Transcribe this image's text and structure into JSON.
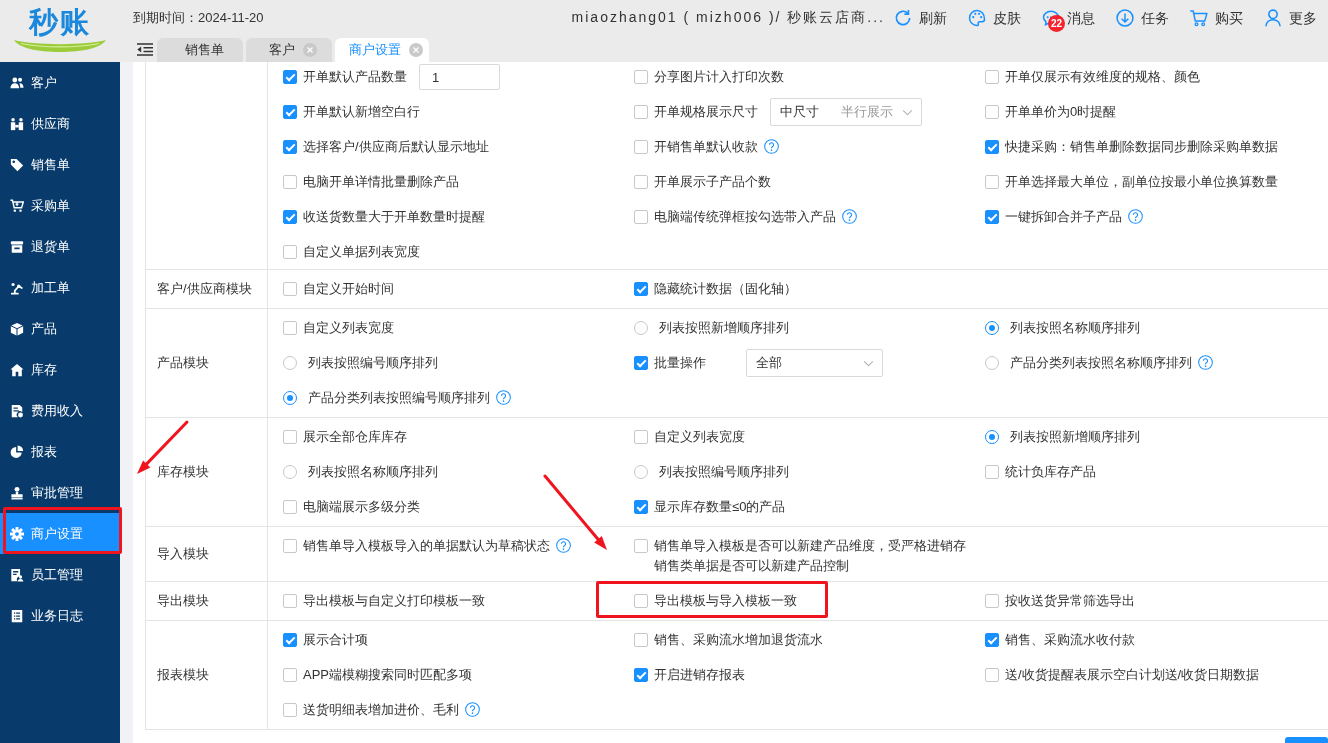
{
  "header": {
    "logo": "秒账",
    "expiry": "到期时间：2024-11-20",
    "account": "miaozhang01 ( mizh006 )/ 秒账云店商...",
    "toolbar": [
      {
        "kind": "refresh",
        "label": "刷新"
      },
      {
        "kind": "skin",
        "label": "皮肤"
      },
      {
        "kind": "messages",
        "label": "消息",
        "badge": "22"
      },
      {
        "kind": "tasks",
        "label": "任务"
      },
      {
        "kind": "buy",
        "label": "购买"
      },
      {
        "kind": "more",
        "label": "更多"
      }
    ]
  },
  "tabs": [
    {
      "label": "销售单",
      "selected": false,
      "closable": false
    },
    {
      "label": "客户",
      "selected": false,
      "closable": true
    },
    {
      "label": "商户设置",
      "selected": true,
      "closable": true
    }
  ],
  "sidebar": {
    "items": [
      {
        "kind": "customers",
        "label": "客户",
        "selected": false
      },
      {
        "kind": "suppliers",
        "label": "供应商",
        "selected": false
      },
      {
        "kind": "sales",
        "label": "销售单",
        "selected": false
      },
      {
        "kind": "purchases",
        "label": "采购单",
        "selected": false
      },
      {
        "kind": "returns",
        "label": "退货单",
        "selected": false
      },
      {
        "kind": "processing",
        "label": "加工单",
        "selected": false
      },
      {
        "kind": "products",
        "label": "产品",
        "selected": false
      },
      {
        "kind": "stock",
        "label": "库存",
        "selected": false
      },
      {
        "kind": "finance",
        "label": "费用收入",
        "selected": false
      },
      {
        "kind": "reports",
        "label": "报表",
        "selected": false
      },
      {
        "kind": "approvals",
        "label": "审批管理",
        "selected": false
      },
      {
        "kind": "settings",
        "label": "商户设置",
        "selected": true
      },
      {
        "kind": "staff",
        "label": "员工管理",
        "selected": false
      },
      {
        "kind": "logs",
        "label": "业务日志",
        "selected": false
      }
    ]
  },
  "settings": {
    "sections": [
      {
        "items": [
          {
            "kind": "checkbox",
            "label": "开单默认产品数量",
            "checked": true,
            "help": false,
            "field": {
              "value": "1"
            }
          },
          {
            "kind": "checkbox",
            "label": "分享图片计入打印次数",
            "checked": false,
            "help": false
          },
          {
            "kind": "checkbox",
            "label": "开单仅展示有效维度的规格、颜色",
            "checked": false,
            "help": false
          },
          {
            "kind": "checkbox",
            "label": "开单默认新增空白行",
            "checked": true,
            "help": false
          },
          {
            "kind": "checkbox",
            "label": "开单规格展示尺寸",
            "checked": false,
            "help": false,
            "select": {
              "value": "中尺寸",
              "note": "半行展示"
            }
          },
          {
            "kind": "checkbox",
            "label": "开单单价为0时提醒",
            "checked": false,
            "help": false
          },
          {
            "kind": "checkbox",
            "label": "选择客户/供应商后默认显示地址",
            "checked": true,
            "help": false
          },
          {
            "kind": "checkbox",
            "label": "开销售单默认收款",
            "checked": false,
            "help": true
          },
          {
            "kind": "checkbox",
            "label": "快捷采购：销售单删除数据同步删除采购单数据",
            "checked": true,
            "help": false
          },
          {
            "kind": "checkbox",
            "label": "电脑开单详情批量删除产品",
            "checked": false,
            "help": false
          },
          {
            "kind": "checkbox",
            "label": "开单展示子产品个数",
            "checked": false,
            "help": false
          },
          {
            "kind": "checkbox",
            "label": "开单选择最大单位，副单位按最小单位换算数量",
            "checked": false,
            "help": false
          },
          {
            "kind": "checkbox",
            "label": "收送货数量大于开单数量时提醒",
            "checked": true,
            "help": false
          },
          {
            "kind": "checkbox",
            "label": "电脑端传统弹框按勾选带入产品",
            "checked": false,
            "help": true
          },
          {
            "kind": "checkbox",
            "label": "一键拆卸合并子产品",
            "checked": true,
            "help": true
          },
          {
            "kind": "checkbox",
            "label": "自定义单据列表宽度",
            "checked": false,
            "help": false
          }
        ]
      },
      {
        "title": "客户/供应商模块",
        "items": [
          {
            "kind": "checkbox",
            "label": "自定义开始时间",
            "checked": false,
            "help": false
          },
          {
            "kind": "checkbox",
            "label": "隐藏统计数据（固化轴）",
            "checked": true,
            "help": false
          }
        ]
      },
      {
        "title": "产品模块",
        "items": [
          {
            "kind": "checkbox",
            "label": "自定义列表宽度",
            "checked": false,
            "help": false
          },
          {
            "kind": "radio",
            "label": "列表按照新增顺序排列",
            "selected": false,
            "help": false
          },
          {
            "kind": "radio",
            "label": "列表按照名称顺序排列",
            "selected": true,
            "help": false
          },
          {
            "kind": "radio",
            "label": "列表按照编号顺序排列",
            "selected": false,
            "help": false
          },
          {
            "kind": "checkbox",
            "label": "批量操作",
            "checked": true,
            "help": false,
            "select": {
              "value": "全部"
            }
          },
          {
            "kind": "radio",
            "label": "产品分类列表按照名称顺序排列",
            "selected": false,
            "help": true
          },
          {
            "kind": "radio",
            "label": "产品分类列表按照编号顺序排列",
            "selected": true,
            "help": true
          }
        ]
      },
      {
        "title": "库存模块",
        "items": [
          {
            "kind": "checkbox",
            "label": "展示全部仓库库存",
            "checked": false,
            "help": false
          },
          {
            "kind": "checkbox",
            "label": "自定义列表宽度",
            "checked": false,
            "help": false
          },
          {
            "kind": "radio",
            "label": "列表按照新增顺序排列",
            "selected": true,
            "help": false
          },
          {
            "kind": "radio",
            "label": "列表按照名称顺序排列",
            "selected": false,
            "help": false
          },
          {
            "kind": "radio",
            "label": "列表按照编号顺序排列",
            "selected": false,
            "help": false
          },
          {
            "kind": "checkbox",
            "label": "统计负库存产品",
            "checked": false,
            "help": false
          },
          {
            "kind": "checkbox",
            "label": "电脑端展示多级分类",
            "checked": false,
            "help": false
          },
          {
            "kind": "checkbox",
            "label": "显示库存数量≤0的产品",
            "checked": true,
            "help": false
          }
        ]
      },
      {
        "title": "导入模块",
        "items": [
          {
            "kind": "checkbox",
            "label": "销售单导入模板导入的单据默认为草稿状态",
            "checked": false,
            "help": true
          },
          {
            "kind": "checkbox",
            "label": "销售单导入模板是否可以新建产品维度，受严格进销存销售类单据是否可以新建产品控制",
            "checked": false,
            "help": false
          }
        ]
      },
      {
        "title": "导出模块",
        "items": [
          {
            "kind": "checkbox",
            "label": "导出模板与自定义打印模板一致",
            "checked": false,
            "help": false
          },
          {
            "kind": "checkbox",
            "label": "导出模板与导入模板一致",
            "checked": false,
            "help": false
          },
          {
            "kind": "checkbox",
            "label": "按收送货异常筛选导出",
            "checked": false,
            "help": false
          }
        ]
      },
      {
        "title": "报表模块",
        "items": [
          {
            "kind": "checkbox",
            "label": "展示合计项",
            "checked": true,
            "help": false
          },
          {
            "kind": "checkbox",
            "label": "销售、采购流水增加退货流水",
            "checked": false,
            "help": false
          },
          {
            "kind": "checkbox",
            "label": "销售、采购流水收付款",
            "checked": true,
            "help": false
          },
          {
            "kind": "checkbox",
            "label": "APP端模糊搜索同时匹配多项",
            "checked": false,
            "help": false
          },
          {
            "kind": "checkbox",
            "label": "开启进销存报表",
            "checked": true,
            "help": false
          },
          {
            "kind": "checkbox",
            "label": "送/收货提醒表展示空白计划送/收货日期数据",
            "checked": false,
            "help": false
          },
          {
            "kind": "checkbox",
            "label": "送货明细表增加进价、毛利",
            "checked": false,
            "help": true
          }
        ]
      }
    ]
  }
}
